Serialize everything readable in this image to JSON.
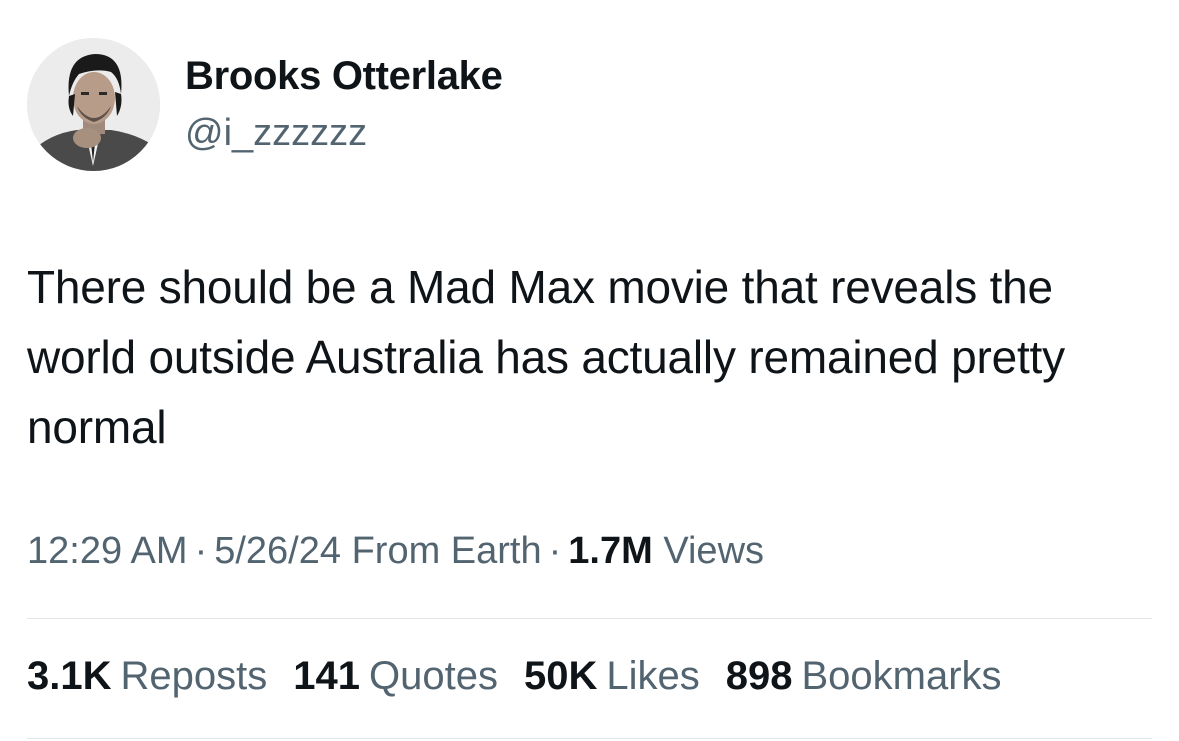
{
  "author": {
    "display_name": "Brooks Otterlake",
    "handle": "@i_zzzzzz"
  },
  "tweet": {
    "text": "There should be a Mad Max movie that reveals the world outside Australia has actually remained pretty normal"
  },
  "meta": {
    "time": "12:29 AM",
    "date": "5/26/24",
    "location": "From Earth",
    "separator": "·",
    "views_count": "1.7M",
    "views_label": "Views"
  },
  "stats": {
    "reposts": {
      "count": "3.1K",
      "label": "Reposts"
    },
    "quotes": {
      "count": "141",
      "label": "Quotes"
    },
    "likes": {
      "count": "50K",
      "label": "Likes"
    },
    "bookmarks": {
      "count": "898",
      "label": "Bookmarks"
    }
  },
  "colors": {
    "text_primary": "#0f1419",
    "text_secondary": "#536471",
    "divider": "#e1e6ea",
    "background": "#ffffff"
  },
  "icons": {
    "avatar": "profile-photo-grayscale"
  }
}
